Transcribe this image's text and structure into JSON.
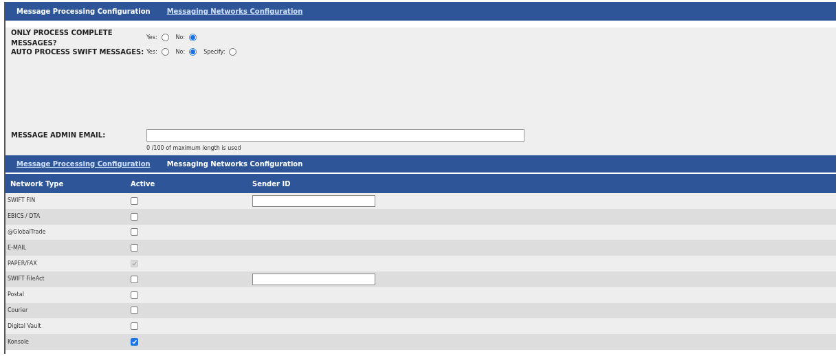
{
  "top_tabs": [
    {
      "label": "Message Processing Configuration",
      "selected": true
    },
    {
      "label": "Messaging Networks Configuration",
      "selected": false
    }
  ],
  "settings": [
    {
      "label": "ONLY PROCESS COMPLETE MESSAGES?",
      "options": [
        {
          "label": "Yes:",
          "selected": false
        },
        {
          "label": "No:",
          "selected": true
        }
      ]
    },
    {
      "label": "AUTO PROCESS SWIFT MESSAGES:",
      "options": [
        {
          "label": "Yes:",
          "selected": false
        },
        {
          "label": "No:",
          "selected": true
        },
        {
          "label": "Specify:",
          "selected": false
        }
      ]
    }
  ],
  "admin_email": {
    "label": "MESSAGE ADMIN EMAIL:",
    "hint": "0 /100 of maximum length is used"
  },
  "bottom_tabs": [
    {
      "label": "Message Processing Configuration",
      "selected": false
    },
    {
      "label": "Messaging Networks Configuration",
      "selected": true
    }
  ],
  "table": {
    "columns": [
      "Network Type",
      "Active",
      "Sender ID"
    ],
    "rows": [
      {
        "name": "SWIFT FIN",
        "checked": false,
        "disabled": false,
        "kind": "sender"
      },
      {
        "name": "EBICS / DTA",
        "checked": false,
        "disabled": false,
        "kind": "plain"
      },
      {
        "name": "@GlobalTrade",
        "checked": false,
        "disabled": false,
        "kind": "plain"
      },
      {
        "name": "E-MAIL",
        "checked": false,
        "disabled": false,
        "kind": "plain"
      },
      {
        "name": "PAPER/FAX",
        "checked": true,
        "disabled": true,
        "kind": "plain"
      },
      {
        "name": "SWIFT FileAct",
        "checked": false,
        "disabled": false,
        "kind": "sender"
      },
      {
        "name": "Postal",
        "checked": false,
        "disabled": false,
        "kind": "plain"
      },
      {
        "name": "Courier",
        "checked": false,
        "disabled": false,
        "kind": "plain"
      },
      {
        "name": "Digital Vault",
        "checked": false,
        "disabled": false,
        "kind": "plain"
      },
      {
        "name": "Konsole",
        "checked": true,
        "disabled": false,
        "kind": "plain"
      }
    ]
  }
}
